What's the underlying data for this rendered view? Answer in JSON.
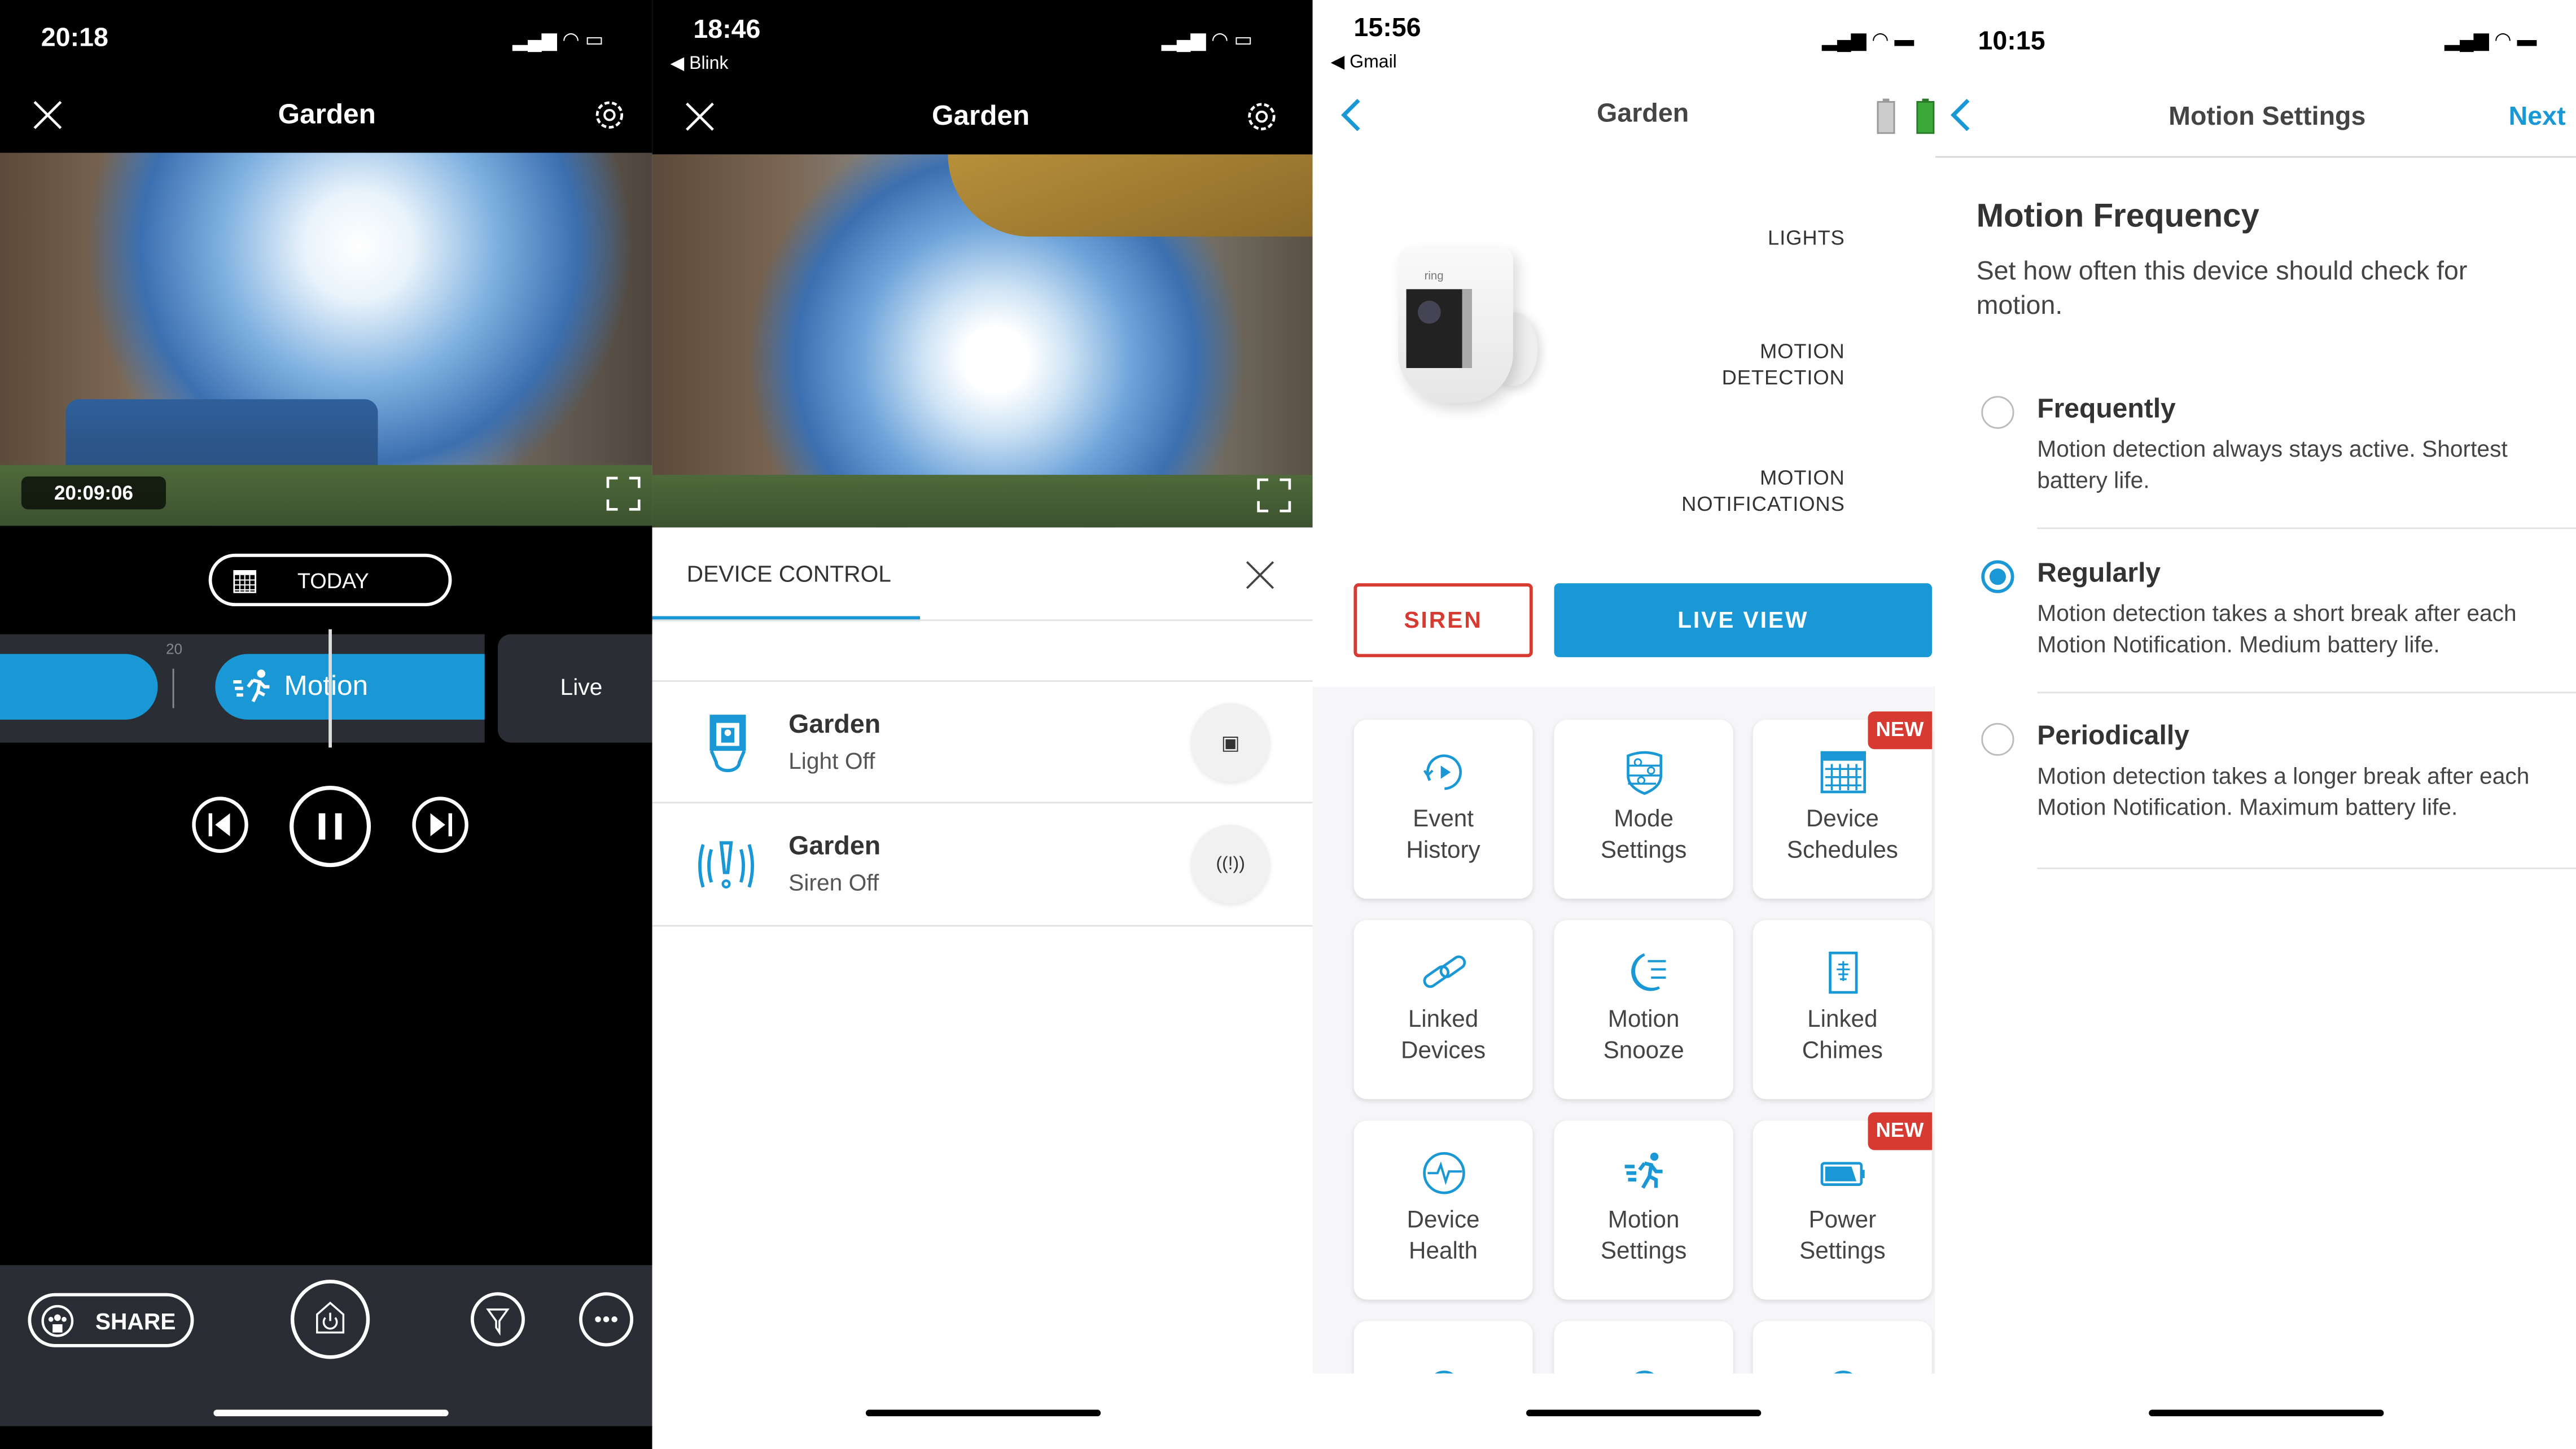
{
  "colors": {
    "accent": "#1998d5",
    "siren_red": "#d63a31",
    "new_badge": "#d63a31",
    "dark_bar": "#2a2d33"
  },
  "panel1": {
    "status_time": "20:18",
    "title": "Garden",
    "icons": [
      "close-icon",
      "gear-icon",
      "fullscreen-icon",
      "calendar-icon",
      "motion-runner-icon",
      "skip-back-icon",
      "pause-icon",
      "skip-forward-icon",
      "share-people-icon",
      "home-power-icon",
      "filter-icon",
      "more-icon"
    ],
    "timestamp": "20:09:06",
    "date_button": "TODAY",
    "timeline_tick": "20",
    "event_label": "Motion",
    "live_label": "Live",
    "share_label": "SHARE"
  },
  "panel2": {
    "status_time": "18:46",
    "back_app": "◀ Blink",
    "title": "Garden",
    "section_title": "DEVICE CONTROL",
    "devices": [
      {
        "name": "Garden",
        "status": "Light Off",
        "icon": "floodlight-icon"
      },
      {
        "name": "Garden",
        "status": "Siren Off",
        "icon": "siren-icon"
      }
    ]
  },
  "panel3": {
    "status_time": "15:56",
    "back_app": "◀ Gmail",
    "title": "Garden",
    "camera_brand": "ring",
    "toggles": [
      {
        "label_lines": [
          "LIGHTS"
        ],
        "on": false
      },
      {
        "label_lines": [
          "MOTION",
          "DETECTION"
        ],
        "on": true
      },
      {
        "label_lines": [
          "MOTION",
          "NOTIFICATIONS"
        ],
        "on": true
      }
    ],
    "siren_button": "SIREN",
    "live_view_button": "LIVE VIEW",
    "new_badge": "NEW",
    "tiles": [
      {
        "l1": "Event",
        "l2": "History",
        "icon": "event-history-icon",
        "new": false
      },
      {
        "l1": "Mode",
        "l2": "Settings",
        "icon": "mode-shield-icon",
        "new": false
      },
      {
        "l1": "Device",
        "l2": "Schedules",
        "icon": "calendar-icon",
        "new": true
      },
      {
        "l1": "Linked",
        "l2": "Devices",
        "icon": "link-icon",
        "new": false
      },
      {
        "l1": "Motion",
        "l2": "Snooze",
        "icon": "moon-icon",
        "new": false
      },
      {
        "l1": "Linked",
        "l2": "Chimes",
        "icon": "chime-icon",
        "new": false
      },
      {
        "l1": "Device",
        "l2": "Health",
        "icon": "health-pulse-icon",
        "new": false
      },
      {
        "l1": "Motion",
        "l2": "Settings",
        "icon": "motion-runner-icon",
        "new": false
      },
      {
        "l1": "Power",
        "l2": "Settings",
        "icon": "battery-icon",
        "new": true
      }
    ]
  },
  "panel4": {
    "status_time": "10:15",
    "title": "Motion Settings",
    "next": "Next",
    "heading": "Motion Frequency",
    "description": "Set how often this device should check for motion.",
    "options": [
      {
        "title": "Frequently",
        "desc": "Motion detection always stays active. Shortest battery life.",
        "selected": false
      },
      {
        "title": "Regularly",
        "desc": "Motion detection takes a short break after each Motion Notification. Medium battery life.",
        "selected": true
      },
      {
        "title": "Periodically",
        "desc": "Motion detection takes a longer break after each Motion Notification. Maximum battery life.",
        "selected": false
      }
    ]
  }
}
